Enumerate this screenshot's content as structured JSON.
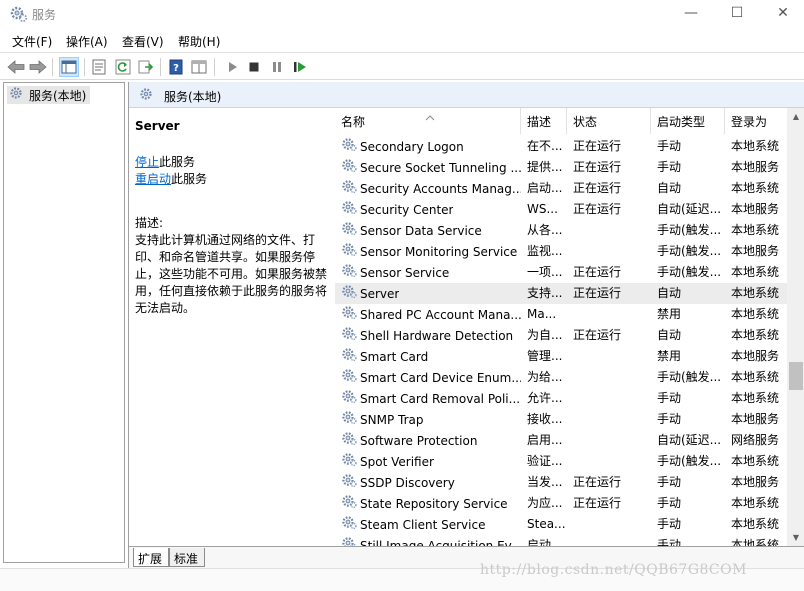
{
  "window": {
    "title": "服务",
    "minimize": "—",
    "maximize": "☐",
    "close": "✕"
  },
  "menu": [
    "文件(F)",
    "操作(A)",
    "查看(V)",
    "帮助(H)"
  ],
  "tree": {
    "root": "服务(本地)"
  },
  "pane": {
    "header": "服务(本地)",
    "selected_name": "Server",
    "stop_link": "停止",
    "stop_suffix": "此服务",
    "restart_link": "重启动",
    "restart_suffix": "此服务",
    "desc_label": "描述:",
    "desc_text": "支持此计算机通过网络的文件、打印、和命名管道共享。如果服务停止，这些功能不可用。如果服务被禁用，任何直接依赖于此服务的服务将无法启动。"
  },
  "columns": {
    "name": "名称",
    "desc": "描述",
    "status": "状态",
    "start": "启动类型",
    "logon": "登录为"
  },
  "services": [
    {
      "name": "Secondary Logon",
      "desc": "在不...",
      "status": "正在运行",
      "start": "手动",
      "logon": "本地系统"
    },
    {
      "name": "Secure Socket Tunneling ...",
      "desc": "提供...",
      "status": "正在运行",
      "start": "手动",
      "logon": "本地服务"
    },
    {
      "name": "Security Accounts Manag...",
      "desc": "启动...",
      "status": "正在运行",
      "start": "自动",
      "logon": "本地系统"
    },
    {
      "name": "Security Center",
      "desc": "WS...",
      "status": "正在运行",
      "start": "自动(延迟...",
      "logon": "本地服务"
    },
    {
      "name": "Sensor Data Service",
      "desc": "从各...",
      "status": "",
      "start": "手动(触发...",
      "logon": "本地系统"
    },
    {
      "name": "Sensor Monitoring Service",
      "desc": "监视...",
      "status": "",
      "start": "手动(触发...",
      "logon": "本地服务"
    },
    {
      "name": "Sensor Service",
      "desc": "一项...",
      "status": "正在运行",
      "start": "手动(触发...",
      "logon": "本地系统"
    },
    {
      "name": "Server",
      "desc": "支持...",
      "status": "正在运行",
      "start": "自动",
      "logon": "本地系统",
      "selected": true
    },
    {
      "name": "Shared PC Account Mana...",
      "desc": "Ma...",
      "status": "",
      "start": "禁用",
      "logon": "本地系统"
    },
    {
      "name": "Shell Hardware Detection",
      "desc": "为自...",
      "status": "正在运行",
      "start": "自动",
      "logon": "本地系统"
    },
    {
      "name": "Smart Card",
      "desc": "管理...",
      "status": "",
      "start": "禁用",
      "logon": "本地服务"
    },
    {
      "name": "Smart Card Device Enum...",
      "desc": "为给...",
      "status": "",
      "start": "手动(触发...",
      "logon": "本地系统"
    },
    {
      "name": "Smart Card Removal Poli...",
      "desc": "允许...",
      "status": "",
      "start": "手动",
      "logon": "本地系统"
    },
    {
      "name": "SNMP Trap",
      "desc": "接收...",
      "status": "",
      "start": "手动",
      "logon": "本地服务"
    },
    {
      "name": "Software Protection",
      "desc": "启用...",
      "status": "",
      "start": "自动(延迟...",
      "logon": "网络服务"
    },
    {
      "name": "Spot Verifier",
      "desc": "验证...",
      "status": "",
      "start": "手动(触发...",
      "logon": "本地系统"
    },
    {
      "name": "SSDP Discovery",
      "desc": "当发...",
      "status": "正在运行",
      "start": "手动",
      "logon": "本地服务"
    },
    {
      "name": "State Repository Service",
      "desc": "为应...",
      "status": "正在运行",
      "start": "手动",
      "logon": "本地系统"
    },
    {
      "name": "Steam Client Service",
      "desc": "Stea...",
      "status": "",
      "start": "手动",
      "logon": "本地系统"
    },
    {
      "name": "Still Image Acquisition Ev...",
      "desc": "启动...",
      "status": "",
      "start": "手动",
      "logon": "本地系统"
    }
  ],
  "tabs": [
    "扩展",
    "标准"
  ],
  "watermark": "http://blog.csdn.net/QQB67G8COM"
}
